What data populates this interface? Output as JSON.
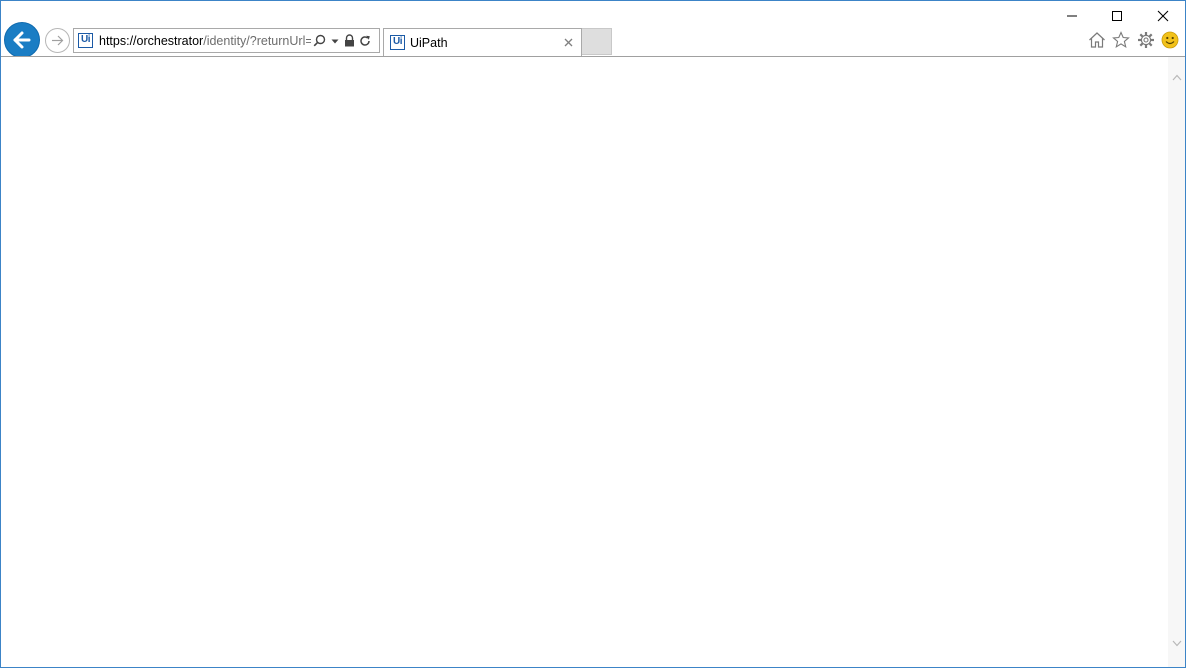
{
  "browser": {
    "address": {
      "url_host": "https://orchestrator",
      "url_rest": "/identity/?returnUrl=",
      "favicon_text": "Ui"
    },
    "tab": {
      "title": "UiPath",
      "favicon_text": "Ui"
    },
    "icons": {
      "back": "back-arrow-icon",
      "forward": "forward-arrow-icon",
      "search": "search-icon",
      "dropdown": "dropdown-icon",
      "lock": "lock-icon",
      "refresh": "refresh-icon",
      "close_tab": "close-icon",
      "home": "home-icon",
      "favorites": "star-icon",
      "settings": "gear-icon",
      "feedback": "smiley-icon",
      "minimize": "minimize-icon",
      "maximize": "maximize-icon",
      "close_window": "close-icon"
    },
    "colors": {
      "accent": "#1a7dc4",
      "window_border": "#3c84c7",
      "favicon": "#1b5aa6",
      "smiley": "#f2c21a"
    }
  }
}
